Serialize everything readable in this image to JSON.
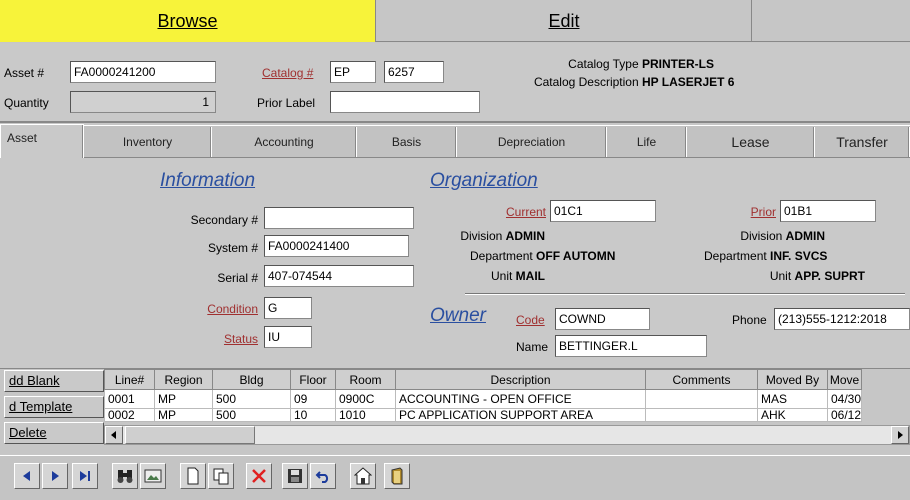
{
  "modes": {
    "browse": "Browse",
    "edit": "Edit"
  },
  "header": {
    "asset_label": "Asset #",
    "asset_value": "FA0000241200",
    "quantity_label": "Quantity",
    "quantity_value": "1",
    "catalog_label": "Catalog #",
    "catalog_prefix": "EP",
    "catalog_number": "6257",
    "prior_label_label": "Prior Label",
    "prior_label_value": "",
    "catalog_type_label": "Catalog Type",
    "catalog_type_value": "PRINTER-LS",
    "catalog_desc_label": "Catalog Description",
    "catalog_desc_value": "HP LASERJET 6"
  },
  "tabs": [
    "Asset",
    "Inventory",
    "Accounting",
    "Basis",
    "Depreciation",
    "Life",
    "Lease",
    "Transfer"
  ],
  "information": {
    "title": "Information",
    "secondary_label": "Secondary #",
    "secondary_value": "",
    "system_label": "System #",
    "system_value": "FA0000241400",
    "serial_label": "Serial #",
    "serial_value": "407-074544",
    "condition_label": "Condition",
    "condition_value": "G",
    "status_label": "Status",
    "status_value": "IU"
  },
  "organization": {
    "title": "Organization",
    "current_label": "Current",
    "current_value": "01C1",
    "current_division_label": "Division",
    "current_division": "ADMIN",
    "current_department_label": "Department",
    "current_department": "OFF AUTOMN",
    "current_unit_label": "Unit",
    "current_unit": "MAIL",
    "prior_label": "Prior",
    "prior_value": "01B1",
    "prior_division_label": "Division",
    "prior_division": "ADMIN",
    "prior_department_label": "Department",
    "prior_department": "INF. SVCS",
    "prior_unit_label": "Unit",
    "prior_unit": "APP. SUPRT"
  },
  "owner": {
    "title": "Owner",
    "code_label": "Code",
    "code_value": "COWND",
    "name_label": "Name",
    "name_value": "BETTINGER.L",
    "phone_label": "Phone",
    "phone_value": "(213)555-1212:2018"
  },
  "side_buttons": [
    "dd Blank",
    "d Template",
    "Delete"
  ],
  "grid": {
    "columns": [
      "Line#",
      "Region",
      "Bldg",
      "Floor",
      "Room",
      "Description",
      "Comments",
      "Moved By",
      "Move"
    ],
    "rows": [
      [
        "0001",
        "MP",
        "500",
        "09",
        "0900C",
        "ACCOUNTING - OPEN OFFICE",
        "",
        "MAS",
        "04/30"
      ],
      [
        "0002",
        "MP",
        "500",
        "10",
        "1010",
        "PC APPLICATION SUPPORT AREA",
        "",
        "AHK",
        "06/12"
      ]
    ]
  },
  "toolbar": {
    "icons": [
      "prev-icon",
      "next-icon",
      "last-icon",
      "binoculars-icon",
      "image-icon",
      "new-page-icon",
      "copy-icon",
      "delete-x-icon",
      "save-icon",
      "undo-icon",
      "home-icon",
      "book-icon"
    ]
  },
  "colors": {
    "browse_tab": "#f7f33a",
    "section_title": "#2a4fa0",
    "link_label": "#a03030",
    "delete_x": "#e02020"
  }
}
